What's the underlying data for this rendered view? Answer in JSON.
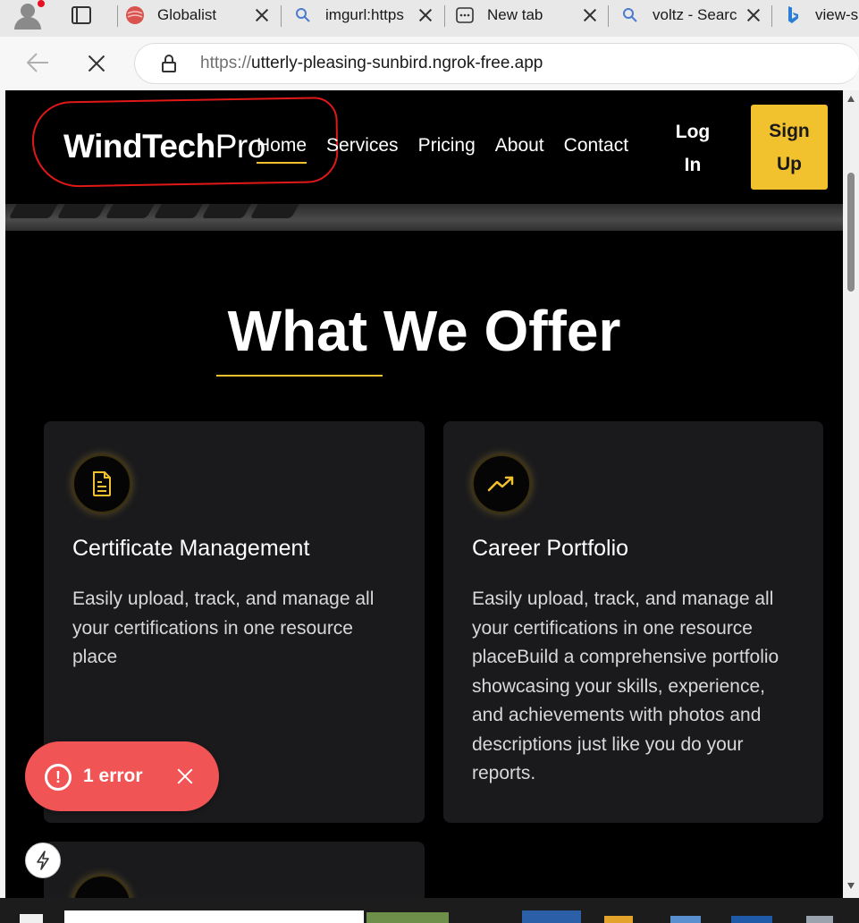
{
  "browser": {
    "tabs": [
      {
        "title": "Globalist",
        "icon": "globalist-favicon-icon"
      },
      {
        "title": "imgurl:https",
        "icon": "search-icon"
      },
      {
        "title": "New tab",
        "icon": "new-tab-icon"
      },
      {
        "title": "voltz - Searc",
        "icon": "search-icon"
      },
      {
        "title": "view-s",
        "icon": "bing-icon"
      }
    ],
    "url_protocol": "https://",
    "url_host": "utterly-pleasing-sunbird.ngrok-free.app"
  },
  "site": {
    "logo_main": "WindTech",
    "logo_suffix": "Pro",
    "nav": [
      "Home",
      "Services",
      "Pricing",
      "About",
      "Contact"
    ],
    "active_nav": "Home",
    "login_label": "Log In",
    "signup_label": "Sign Up",
    "accent_color": "#f2c12e"
  },
  "section": {
    "heading": "What We Offer",
    "cards": [
      {
        "icon": "document-icon",
        "title": "Certificate Management",
        "description": "Easily upload, track, and manage all your certifications in one resource place"
      },
      {
        "icon": "trending-up-icon",
        "title": "Career Portfolio",
        "description": "Easily upload, track, and manage all your certifications in one resource placeBuild a comprehensive portfolio showcasing your skills, experience, and achievements with photos and descriptions just like you do your reports."
      }
    ]
  },
  "overlay": {
    "error_label": "1 error",
    "error_color": "#f05454"
  }
}
